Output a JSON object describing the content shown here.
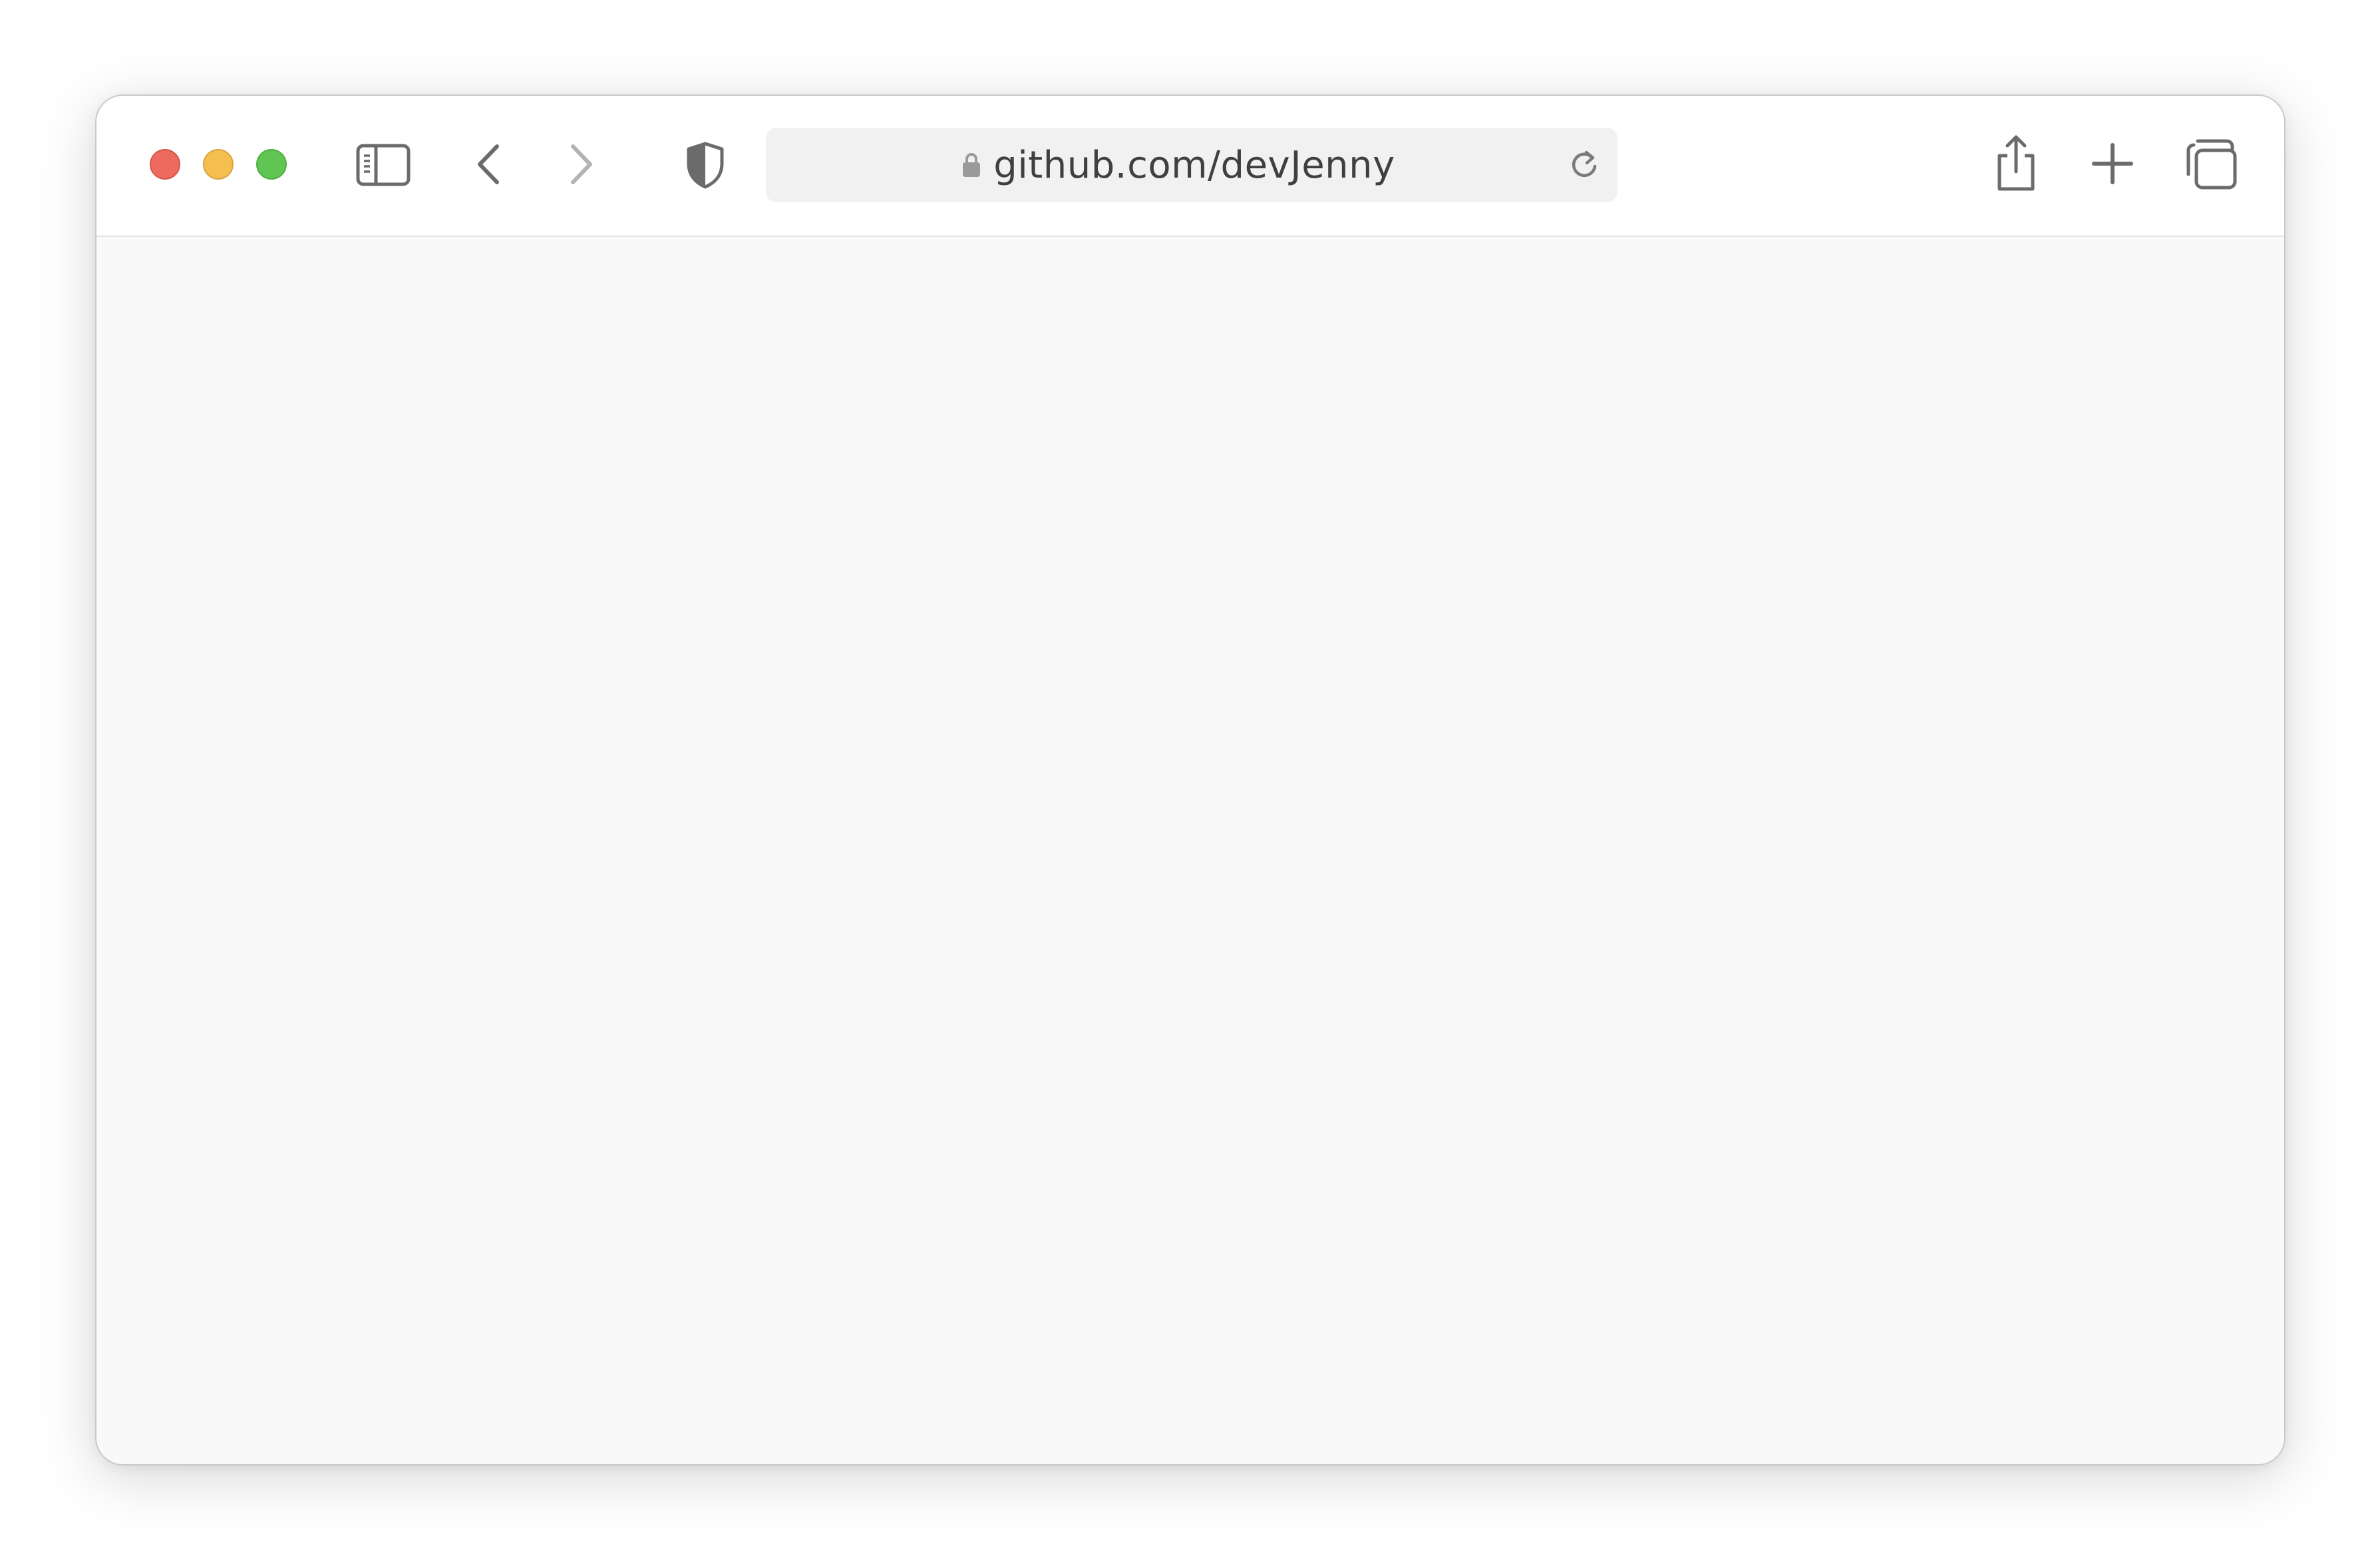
{
  "window": {
    "traffic_lights": [
      {
        "name": "close",
        "color": "#ec6a5e"
      },
      {
        "name": "minimize",
        "color": "#f4bf4f"
      },
      {
        "name": "zoom",
        "color": "#61c554"
      }
    ]
  },
  "toolbar": {
    "icons": {
      "sidebar": "sidebar-icon",
      "back": "chevron-left-icon",
      "forward": "chevron-right-icon",
      "privacy": "shield-icon",
      "share": "share-icon",
      "new_tab": "plus-icon",
      "tabs": "tab-overview-icon"
    },
    "forward_enabled": false
  },
  "address_bar": {
    "url": "github.com/devJenny",
    "secure": true,
    "lock_icon": "lock-icon",
    "reload_icon": "reload-icon"
  },
  "page": {
    "background": "#f9f9f9"
  }
}
